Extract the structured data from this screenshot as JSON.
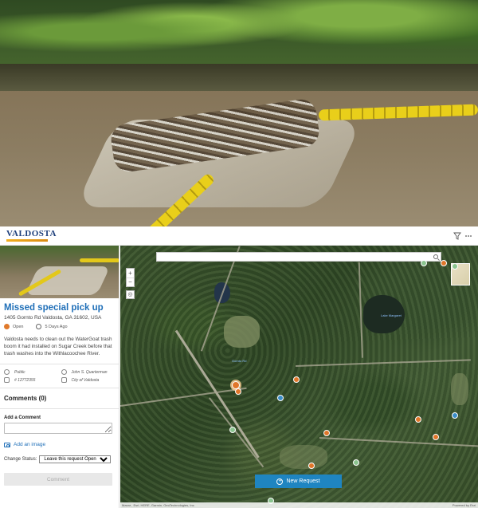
{
  "header": {
    "logo_text": "VALDOSTA",
    "filter_icon": "filter-icon",
    "more_icon": "more-horizontal-icon"
  },
  "request": {
    "title": "Missed special pick up",
    "address": "1405 Gornto Rd Valdosta, GA 31602, USA",
    "status": "Open",
    "age": "5 Days Ago",
    "description": "Valdosta needs to clean out the WaterGoat trash boom it had installed on Sugar Creek before that trash washes into the Withlacoochee River.",
    "visibility": "Public",
    "submitter": "John S. Quarterman",
    "id": "# 12772355",
    "agency": "City of Valdosta",
    "status_color": "#e0762a"
  },
  "comments": {
    "heading": "Comments (0)",
    "add_heading": "Add a Comment",
    "input_value": "",
    "add_image_label": "Add an image",
    "change_status_label": "Change Status:",
    "status_options": [
      "Leave this request Open"
    ],
    "submit_label": "Comment"
  },
  "map": {
    "search_placeholder": "",
    "zoom_in": "+",
    "zoom_out": "−",
    "locate_glyph": "◎",
    "new_request_label": "New Request",
    "attribution": "Maxar , Esri, HERE, Garmin, GeoTechnologies, Inc",
    "powered_by": "Powered by Esri",
    "labels": [
      "Lake Margaret",
      "Gornto Rd"
    ],
    "colors": {
      "open": "#e0762a",
      "in_progress": "#3b8dc8",
      "closed": "#8bc48f",
      "button": "#1f85c1"
    }
  }
}
